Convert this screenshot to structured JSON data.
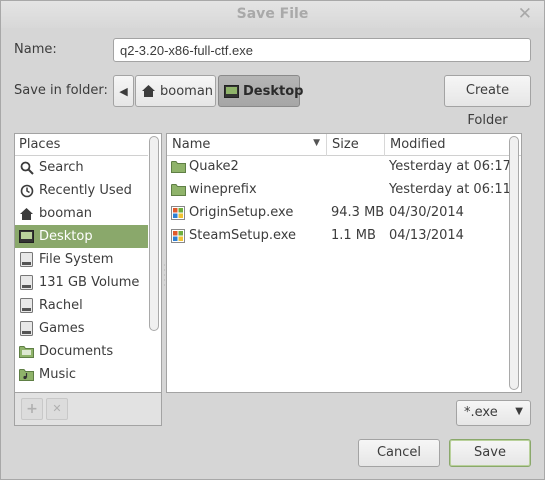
{
  "window": {
    "title": "Save File",
    "close_glyph": "✕"
  },
  "name_field": {
    "label": "Name:",
    "value": "q2-3.20-x86-full-ctf.exe"
  },
  "save_in": {
    "label": "Save in folder:",
    "back_glyph": "◀",
    "crumbs": [
      {
        "label": "booman",
        "icon": "home-icon",
        "active": false
      },
      {
        "label": "Desktop",
        "icon": "desktop-icon",
        "active": true
      }
    ],
    "create_folder": "Create Folder"
  },
  "places": {
    "header": "Places",
    "items": [
      {
        "label": "Search",
        "icon": "search-icon"
      },
      {
        "label": "Recently Used",
        "icon": "clock-icon"
      },
      {
        "label": "booman",
        "icon": "home-icon"
      },
      {
        "label": "Desktop",
        "icon": "desktop-icon",
        "selected": true
      },
      {
        "label": "File System",
        "icon": "drive-icon"
      },
      {
        "label": "131 GB Volume",
        "icon": "drive-icon"
      },
      {
        "label": "Rachel",
        "icon": "drive-icon"
      },
      {
        "label": "Games",
        "icon": "drive-icon"
      },
      {
        "label": "Documents",
        "icon": "folder-icon"
      },
      {
        "label": "Music",
        "icon": "music-folder-icon"
      }
    ],
    "add_glyph": "+",
    "remove_glyph": "✕"
  },
  "files": {
    "columns": {
      "name": "Name",
      "size": "Size",
      "modified": "Modified"
    },
    "sort_glyph": "▼",
    "rows": [
      {
        "name": "Quake2",
        "size": "",
        "modified": "Yesterday at 06:17",
        "icon": "folder-icon"
      },
      {
        "name": "wineprefix",
        "size": "",
        "modified": "Yesterday at 06:11",
        "icon": "folder-icon"
      },
      {
        "name": "OriginSetup.exe",
        "size": "94.3 MB",
        "modified": "04/30/2014",
        "icon": "exe-icon"
      },
      {
        "name": "SteamSetup.exe",
        "size": "1.1 MB",
        "modified": "04/13/2014",
        "icon": "exe-icon"
      }
    ]
  },
  "filter": {
    "value": "*.exe",
    "caret": "▼"
  },
  "buttons": {
    "cancel": "Cancel",
    "save": "Save"
  },
  "colors": {
    "accent": "#8aa86b",
    "folder": "#8fb36a",
    "background": "#d6d6d6"
  }
}
